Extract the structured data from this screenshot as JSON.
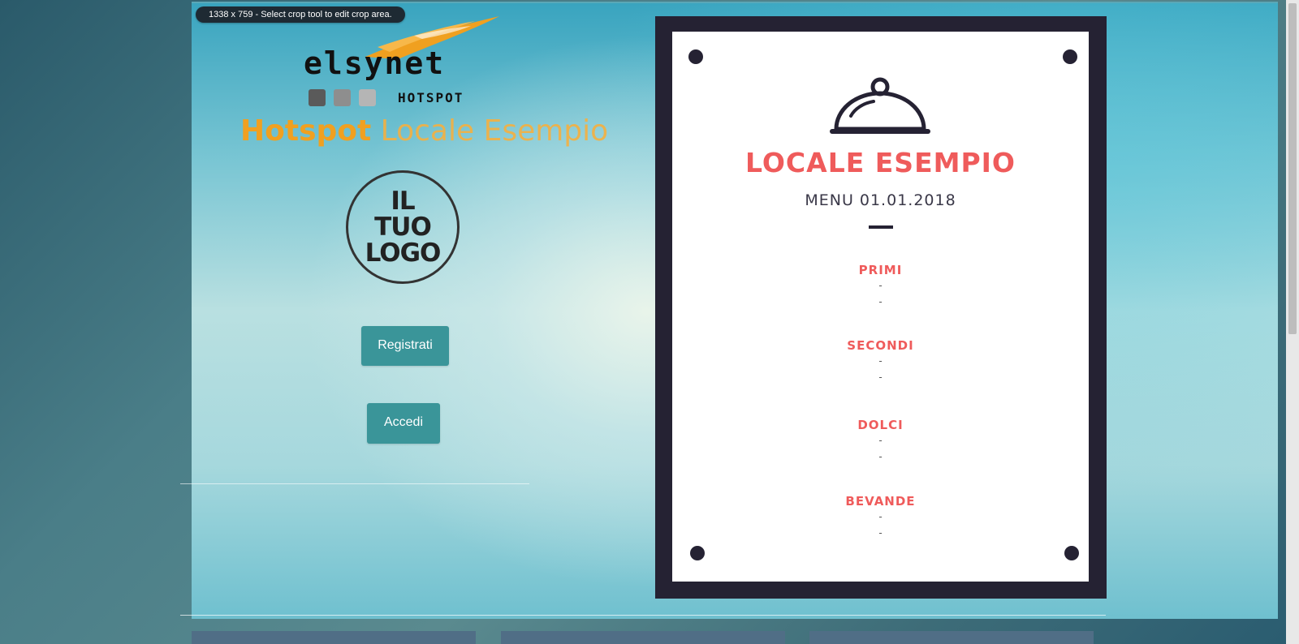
{
  "crop_badge": "1338 x 759 - Select crop tool to edit crop area.",
  "brand": {
    "name": "elsynet",
    "sub": "HOTSPOT",
    "accent_color": "#f0a020"
  },
  "title": {
    "bold": "Hotspot",
    "light": "Locale Esempio"
  },
  "logo": {
    "lines": [
      "IL",
      "TUO",
      "LOGO"
    ]
  },
  "buttons": {
    "register": "Registrati",
    "login": "Accedi",
    "color": "#3a9599"
  },
  "menu": {
    "title": "LOCALE ESEMPIO",
    "date": "MENU 01.01.2018",
    "title_color": "#ef5b5b",
    "frame_color": "#252233",
    "sections": [
      {
        "name": "PRIMI",
        "items": [
          "-",
          "-"
        ]
      },
      {
        "name": "SECONDI",
        "items": [
          "-",
          "-"
        ]
      },
      {
        "name": "DOLCI",
        "items": [
          "-",
          "-"
        ]
      },
      {
        "name": "BEVANDE",
        "items": [
          "-",
          "-"
        ]
      }
    ]
  },
  "icons": {
    "cloche": "cloche-icon",
    "pins": "pin-icon"
  }
}
